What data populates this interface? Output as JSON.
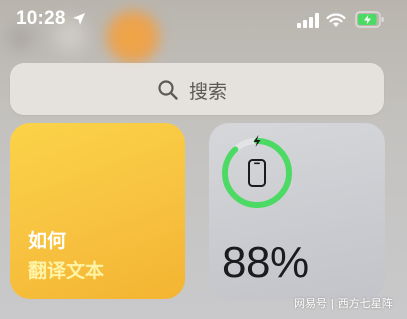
{
  "status_bar": {
    "time": "10:28",
    "location_icon": "location-arrow-icon",
    "signal_icon": "cellular-signal-icon",
    "wifi_icon": "wifi-icon",
    "battery_icon": "battery-charging-icon",
    "battery_color": "#4cd964"
  },
  "search": {
    "placeholder": "搜索",
    "icon": "search-icon"
  },
  "translate_widget": {
    "title": "如何",
    "subtitle": "翻译文本",
    "color": "#f7c240"
  },
  "battery_widget": {
    "percent_label": "88%",
    "level": 0.88,
    "charging": true,
    "ring_color": "#4cd964",
    "icon": "iphone-icon"
  },
  "watermark": {
    "text": "网易号 | 西方七星阵"
  }
}
